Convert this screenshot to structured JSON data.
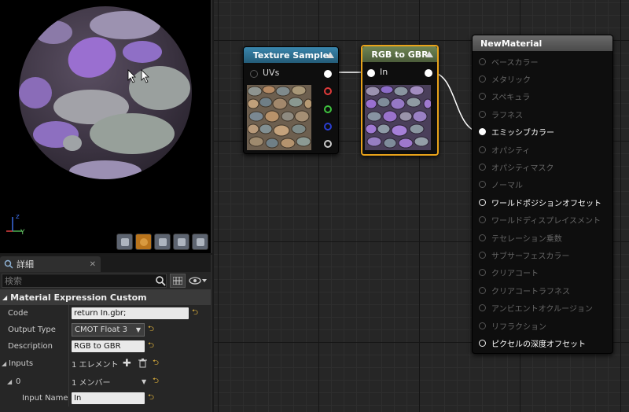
{
  "viewport": {
    "axis_labels": {
      "z": "z",
      "y": "Y"
    }
  },
  "details_panel": {
    "tab_label": "詳細",
    "search_placeholder": "検索",
    "section_title": "Material Expression Custom",
    "properties": [
      {
        "label": "Code",
        "value": "return In.gbr;"
      },
      {
        "label": "Output Type",
        "value": "CMOT Float 3"
      },
      {
        "label": "Description",
        "value": "RGB to GBR"
      }
    ],
    "inputs": {
      "label": "Inputs",
      "count_text": "1 エレメント",
      "index_label": "0",
      "member_text": "1 メンバー",
      "input_name_label": "Input Name",
      "input_name_value": "In"
    }
  },
  "graph": {
    "texture_sample": {
      "title": "Texture Sample",
      "input_label": "UVs",
      "title_color": "#2f6e8e"
    },
    "rgb_to_gbr": {
      "title": "RGB to GBR",
      "input_label": "In",
      "title_color": "#5a6b45",
      "selection_color": "#e8a21a"
    },
    "new_material": {
      "title": "NewMaterial",
      "pins": [
        {
          "label": "ベースカラー",
          "state": "inactive"
        },
        {
          "label": "メタリック",
          "state": "inactive"
        },
        {
          "label": "スペキュラ",
          "state": "inactive"
        },
        {
          "label": "ラフネス",
          "state": "inactive"
        },
        {
          "label": "エミッシブカラー",
          "state": "connected"
        },
        {
          "label": "オパシティ",
          "state": "inactive"
        },
        {
          "label": "オパシティマスク",
          "state": "inactive"
        },
        {
          "label": "ノーマル",
          "state": "inactive"
        },
        {
          "label": "ワールドポジションオフセット",
          "state": "active"
        },
        {
          "label": "ワールドディスプレイスメント",
          "state": "inactive"
        },
        {
          "label": "テセレーション乗数",
          "state": "inactive"
        },
        {
          "label": "サブサーフェスカラー",
          "state": "inactive"
        },
        {
          "label": "クリアコート",
          "state": "inactive"
        },
        {
          "label": "クリアコートラフネス",
          "state": "inactive"
        },
        {
          "label": "アンビエントオクルージョン",
          "state": "inactive"
        },
        {
          "label": "リフラクション",
          "state": "inactive"
        },
        {
          "label": "ピクセルの深度オフセット",
          "state": "active"
        }
      ]
    }
  }
}
